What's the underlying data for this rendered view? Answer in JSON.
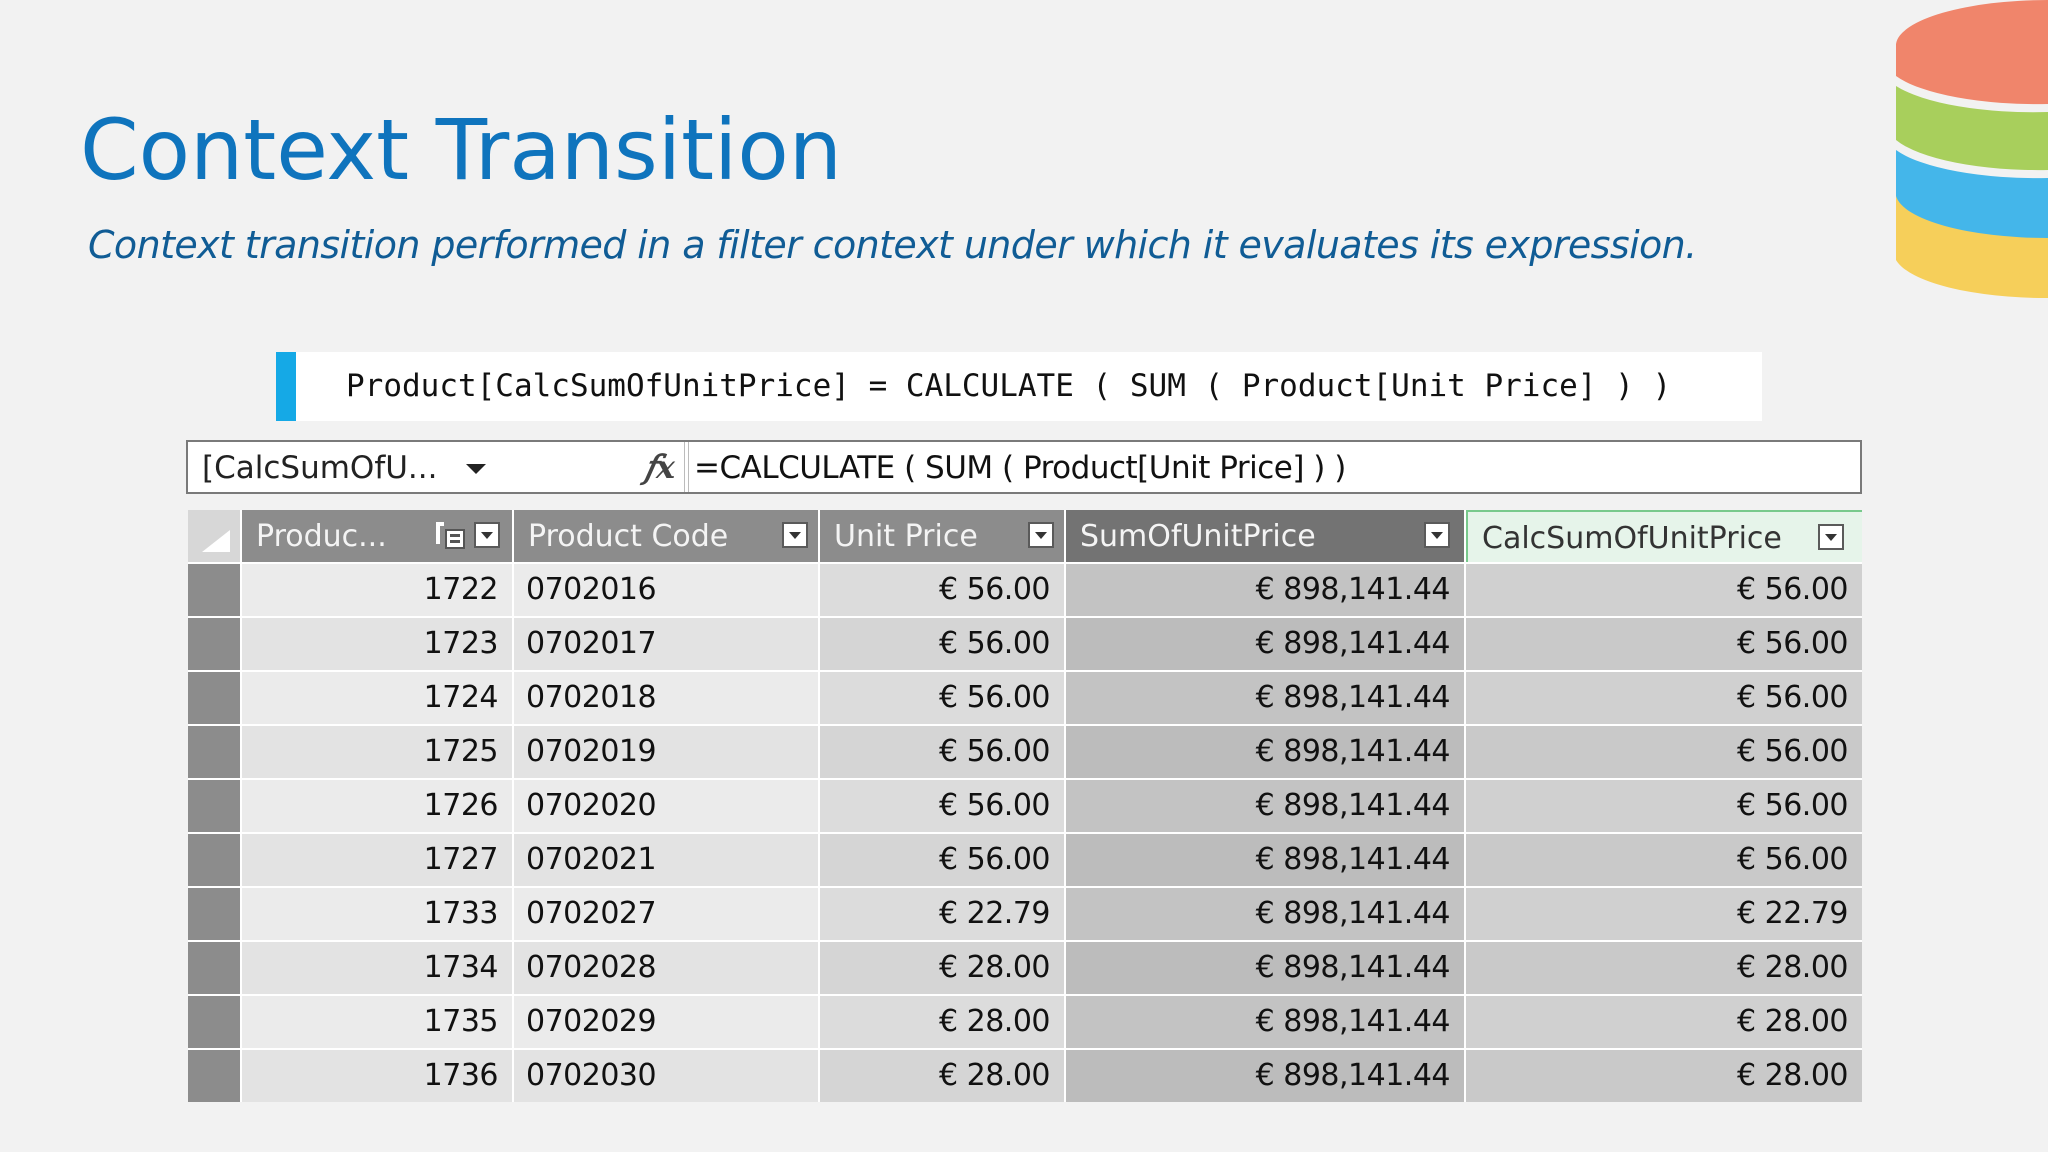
{
  "slide": {
    "title": "Context Transition",
    "subtitle": "Context transition performed in a filter context under which it evaluates its expression."
  },
  "code": {
    "text": "Product[CalcSumOfUnitPrice] = CALCULATE ( SUM ( Product[Unit Price] ) )"
  },
  "formula_bar": {
    "name_box": "[CalcSumOfU...",
    "fx_icon": "fx-icon",
    "formula": "=CALCULATE ( SUM ( Product[Unit Price] ) )"
  },
  "table": {
    "columns": [
      "Produc...",
      "Product Code",
      "Unit Price",
      "SumOfUnitPrice",
      "CalcSumOfUnitPrice"
    ],
    "rows": [
      [
        "1722",
        "0702016",
        "€ 56.00",
        "€ 898,141.44",
        "€ 56.00"
      ],
      [
        "1723",
        "0702017",
        "€ 56.00",
        "€ 898,141.44",
        "€ 56.00"
      ],
      [
        "1724",
        "0702018",
        "€ 56.00",
        "€ 898,141.44",
        "€ 56.00"
      ],
      [
        "1725",
        "0702019",
        "€ 56.00",
        "€ 898,141.44",
        "€ 56.00"
      ],
      [
        "1726",
        "0702020",
        "€ 56.00",
        "€ 898,141.44",
        "€ 56.00"
      ],
      [
        "1727",
        "0702021",
        "€ 56.00",
        "€ 898,141.44",
        "€ 56.00"
      ],
      [
        "1733",
        "0702027",
        "€ 22.79",
        "€ 898,141.44",
        "€ 22.79"
      ],
      [
        "1734",
        "0702028",
        "€ 28.00",
        "€ 898,141.44",
        "€ 28.00"
      ],
      [
        "1735",
        "0702029",
        "€ 28.00",
        "€ 898,141.44",
        "€ 28.00"
      ],
      [
        "1736",
        "0702030",
        "€ 28.00",
        "€ 898,141.44",
        "€ 28.00"
      ]
    ]
  },
  "colors": {
    "title": "#0f74bd",
    "subtitle": "#105c95",
    "code_accent": "#15a9e6",
    "db_layers": [
      "#f0856b",
      "#a8cf5c",
      "#44b6ea",
      "#f6cf5a"
    ]
  }
}
